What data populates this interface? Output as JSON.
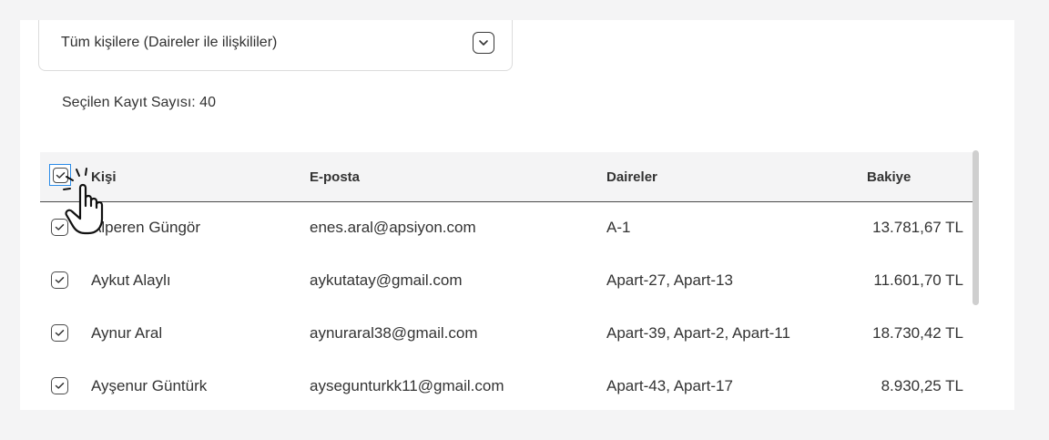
{
  "filter": {
    "selected_label": "Tüm kişilere (Daireler ile ilişkililer)",
    "toggle_icon": "chevron-down-icon"
  },
  "selection": {
    "count_text": "Seçilen Kayıt Sayısı: 40"
  },
  "table": {
    "columns": [
      "Kişi",
      "E-posta",
      "Daireler",
      "Bakiye"
    ],
    "rows": [
      {
        "name": "Alperen Güngör",
        "email": "enes.aral@apsiyon.com",
        "units": "A-1",
        "balance": "13.781,67 TL",
        "checked": true
      },
      {
        "name": "Aykut Alaylı",
        "email": "aykutatay@gmail.com",
        "units": "Apart-27, Apart-13",
        "balance": "11.601,70 TL",
        "checked": true
      },
      {
        "name": "Aynur Aral",
        "email": "aynuraral38@gmail.com",
        "units": "Apart-39, Apart-2, Apart-11",
        "balance": "18.730,42 TL",
        "checked": true
      },
      {
        "name": "Ayşenur Güntürk",
        "email": "aysegunturkk11@gmail.com",
        "units": "Apart-43, Apart-17",
        "balance": "8.930,25 TL",
        "checked": true
      }
    ]
  },
  "colors": {
    "focus_outline": "#2a8be8",
    "header_bg": "#f4f4f5"
  }
}
